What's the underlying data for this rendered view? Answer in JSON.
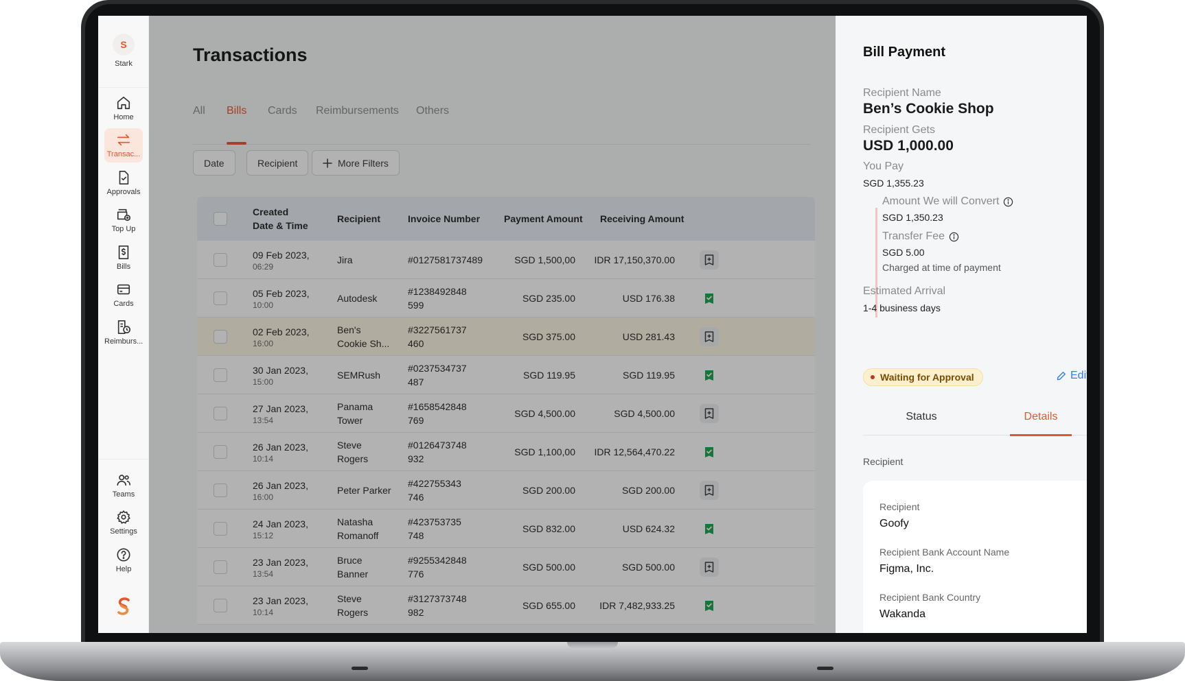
{
  "sidebar": {
    "user_initial": "S",
    "user_name": "Stark",
    "items": [
      {
        "label": "Home",
        "icon": "home-icon"
      },
      {
        "label": "Transac...",
        "icon": "transfer-arrows-icon",
        "active": true
      },
      {
        "label": "Approvals",
        "icon": "document-check-icon"
      },
      {
        "label": "Top Up",
        "icon": "wallet-plus-icon"
      },
      {
        "label": "Bills",
        "icon": "bill-dollar-icon"
      },
      {
        "label": "Cards",
        "icon": "credit-card-icon"
      },
      {
        "label": "Reimburs...",
        "icon": "receipt-clock-icon"
      }
    ],
    "bottom_items": [
      {
        "label": "Teams",
        "icon": "users-icon"
      },
      {
        "label": "Settings",
        "icon": "gear-icon"
      },
      {
        "label": "Help",
        "icon": "help-circle-icon"
      }
    ],
    "brand_color": "#E4572E"
  },
  "page": {
    "title": "Transactions",
    "tabs": [
      {
        "label": "All"
      },
      {
        "label": "Bills",
        "active": true
      },
      {
        "label": "Cards"
      },
      {
        "label": "Reimbursements"
      },
      {
        "label": "Others"
      }
    ],
    "filters": {
      "date": "Date",
      "recipient": "Recipient",
      "more": "More Filters"
    }
  },
  "table": {
    "columns": {
      "created_line1": "Created",
      "created_line2": "Date & Time",
      "recipient": "Recipient",
      "invoice": "Invoice Number",
      "payment": "Payment Amount",
      "receiving": "Receiving Amount"
    },
    "rows": [
      {
        "date": "09 Feb 2023,",
        "time": "06:29",
        "recipient1": "Jira",
        "recipient2": "",
        "inv1": "#0127581737489",
        "inv2": "",
        "payment": "SGD 1,500,00",
        "receiving": "IDR 17,150,370.00",
        "status": "pending"
      },
      {
        "date": "05 Feb 2023,",
        "time": "10:00",
        "recipient1": "Autodesk",
        "recipient2": "",
        "inv1": "#1238492848",
        "inv2": "599",
        "payment": "SGD 235.00",
        "receiving": "USD 176.38",
        "status": "done"
      },
      {
        "date": "02 Feb 2023,",
        "time": "16:00",
        "recipient1": "Ben's",
        "recipient2": "Cookie Sh...",
        "inv1": "#3227561737",
        "inv2": "460",
        "payment": "SGD 375.00",
        "receiving": "USD 281.43",
        "status": "pending",
        "highlight": true
      },
      {
        "date": "30 Jan 2023,",
        "time": "15:00",
        "recipient1": "SEMRush",
        "recipient2": "",
        "inv1": "#0237534737",
        "inv2": "487",
        "payment": "SGD 119.95",
        "receiving": "SGD 119.95",
        "status": "done"
      },
      {
        "date": "27 Jan 2023,",
        "time": "13:54",
        "recipient1": "Panama",
        "recipient2": "Tower",
        "inv1": "#1658542848",
        "inv2": "769",
        "payment": "SGD 4,500.00",
        "receiving": "SGD 4,500.00",
        "status": "pending"
      },
      {
        "date": "26 Jan 2023,",
        "time": "10:14",
        "recipient1": "Steve",
        "recipient2": "Rogers",
        "inv1": "#0126473748",
        "inv2": "932",
        "payment": "SGD 1,100,00",
        "receiving": "IDR 12,564,470.22",
        "status": "done"
      },
      {
        "date": "26 Jan 2023,",
        "time": "16:00",
        "recipient1": "Peter Parker",
        "recipient2": "",
        "inv1": "#422755343",
        "inv2": "746",
        "payment": "SGD 200.00",
        "receiving": "SGD 200.00",
        "status": "pending"
      },
      {
        "date": "24 Jan 2023,",
        "time": "15:12",
        "recipient1": "Natasha",
        "recipient2": "Romanoff",
        "inv1": "#423753735",
        "inv2": "748",
        "payment": "SGD 832.00",
        "receiving": "USD 624.32",
        "status": "done"
      },
      {
        "date": "23 Jan 2023,",
        "time": "13:54",
        "recipient1": "Bruce",
        "recipient2": "Banner",
        "inv1": "#9255342848",
        "inv2": "776",
        "payment": "SGD 500.00",
        "receiving": "SGD 500.00",
        "status": "pending"
      },
      {
        "date": "23 Jan 2023,",
        "time": "10:14",
        "recipient1": "Steve",
        "recipient2": "Rogers",
        "inv1": "#3127373748",
        "inv2": "982",
        "payment": "SGD 655.00",
        "receiving": "IDR 7,482,933.25",
        "status": "done"
      }
    ]
  },
  "drawer": {
    "title": "Bill Payment",
    "recipient_name_label": "Recipient Name",
    "recipient_name": "Ben’s Cookie Shop",
    "recipient_gets_label": "Recipient Gets",
    "recipient_gets": "USD 1,000.00",
    "you_pay_label": "You Pay",
    "you_pay": "SGD 1,355.23",
    "convert_label": "Amount We will Convert",
    "convert_value": "SGD 1,350.23",
    "fee_label": "Transfer Fee",
    "fee_value": "SGD 5.00",
    "fee_note": "Charged at time of payment",
    "arrival_label": "Estimated Arrival",
    "arrival_value": "1-4 business days",
    "status_badge": "Waiting for Approval",
    "edit_label": "Edit Bill",
    "tabs": [
      {
        "label": "Status"
      },
      {
        "label": "Details",
        "active": true
      }
    ],
    "section_label": "Recipient",
    "details": [
      {
        "label": "Recipient",
        "value": "Goofy"
      },
      {
        "label": "Recipient Bank Account Name",
        "value": "Figma, Inc."
      },
      {
        "label": "Recipient Bank Country",
        "value": "Wakanda"
      }
    ],
    "accent_color": "#E4572E",
    "link_color": "#2F80ED",
    "badge_color": "#FDF0CF"
  }
}
